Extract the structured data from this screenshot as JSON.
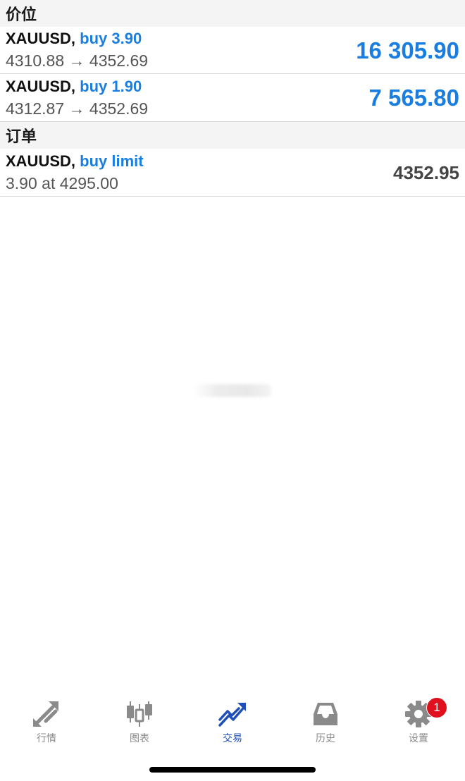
{
  "sections": {
    "positions_title": "价位",
    "orders_title": "订单"
  },
  "positions": [
    {
      "symbol": "XAUUSD,",
      "side": "buy 3.90",
      "prices": "4310.88 → 4352.69",
      "profit": "16 305.90"
    },
    {
      "symbol": "XAUUSD,",
      "side": "buy 1.90",
      "prices": "4312.87 → 4352.69",
      "profit": "7 565.80"
    }
  ],
  "orders": [
    {
      "symbol": "XAUUSD,",
      "side": "buy limit",
      "details": "3.90 at 4295.00",
      "price": "4352.95"
    }
  ],
  "tabbar": {
    "tabs": [
      {
        "label": "行情",
        "icon": "quotes-arrows-icon"
      },
      {
        "label": "图表",
        "icon": "candlestick-chart-icon"
      },
      {
        "label": "交易",
        "icon": "trade-trend-icon"
      },
      {
        "label": "历史",
        "icon": "history-inbox-icon"
      },
      {
        "label": "设置",
        "icon": "settings-gear-icon",
        "badge": "1"
      }
    ],
    "active_tab": "交易"
  },
  "colors": {
    "accent_blue": "#1a7ee0",
    "active_tab": "#1f4fb8",
    "inactive_tab": "#8a8a8a",
    "badge_red": "#e0101e"
  }
}
